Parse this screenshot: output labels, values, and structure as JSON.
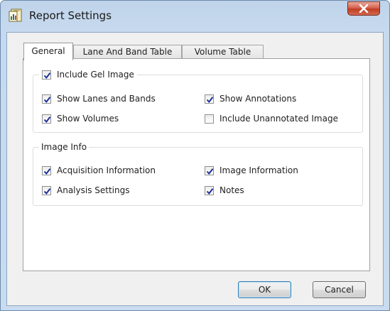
{
  "window": {
    "title": "Report Settings",
    "app_icon": "report-icon",
    "close_icon": "close-icon"
  },
  "tabs": [
    {
      "label": "General",
      "active": true
    },
    {
      "label": "Lane And Band Table",
      "active": false
    },
    {
      "label": "Volume Table",
      "active": false
    }
  ],
  "gel_group": {
    "header": {
      "label": "Include Gel Image",
      "checked": true
    },
    "options": [
      {
        "label": "Show Lanes and Bands",
        "checked": true
      },
      {
        "label": "Show Annotations",
        "checked": true
      },
      {
        "label": "Show Volumes",
        "checked": true
      },
      {
        "label": "Include Unannotated Image",
        "checked": false
      }
    ]
  },
  "info_group": {
    "title": "Image Info",
    "options": [
      {
        "label": "Acquisition Information",
        "checked": true
      },
      {
        "label": "Image Information",
        "checked": true
      },
      {
        "label": "Analysis Settings",
        "checked": true
      },
      {
        "label": "Notes",
        "checked": true
      }
    ]
  },
  "buttons": {
    "ok": "OK",
    "cancel": "Cancel"
  },
  "colors": {
    "check": "#1b2f9c",
    "close_red": "#c13d25",
    "tab_border": "#a0a0a0"
  }
}
